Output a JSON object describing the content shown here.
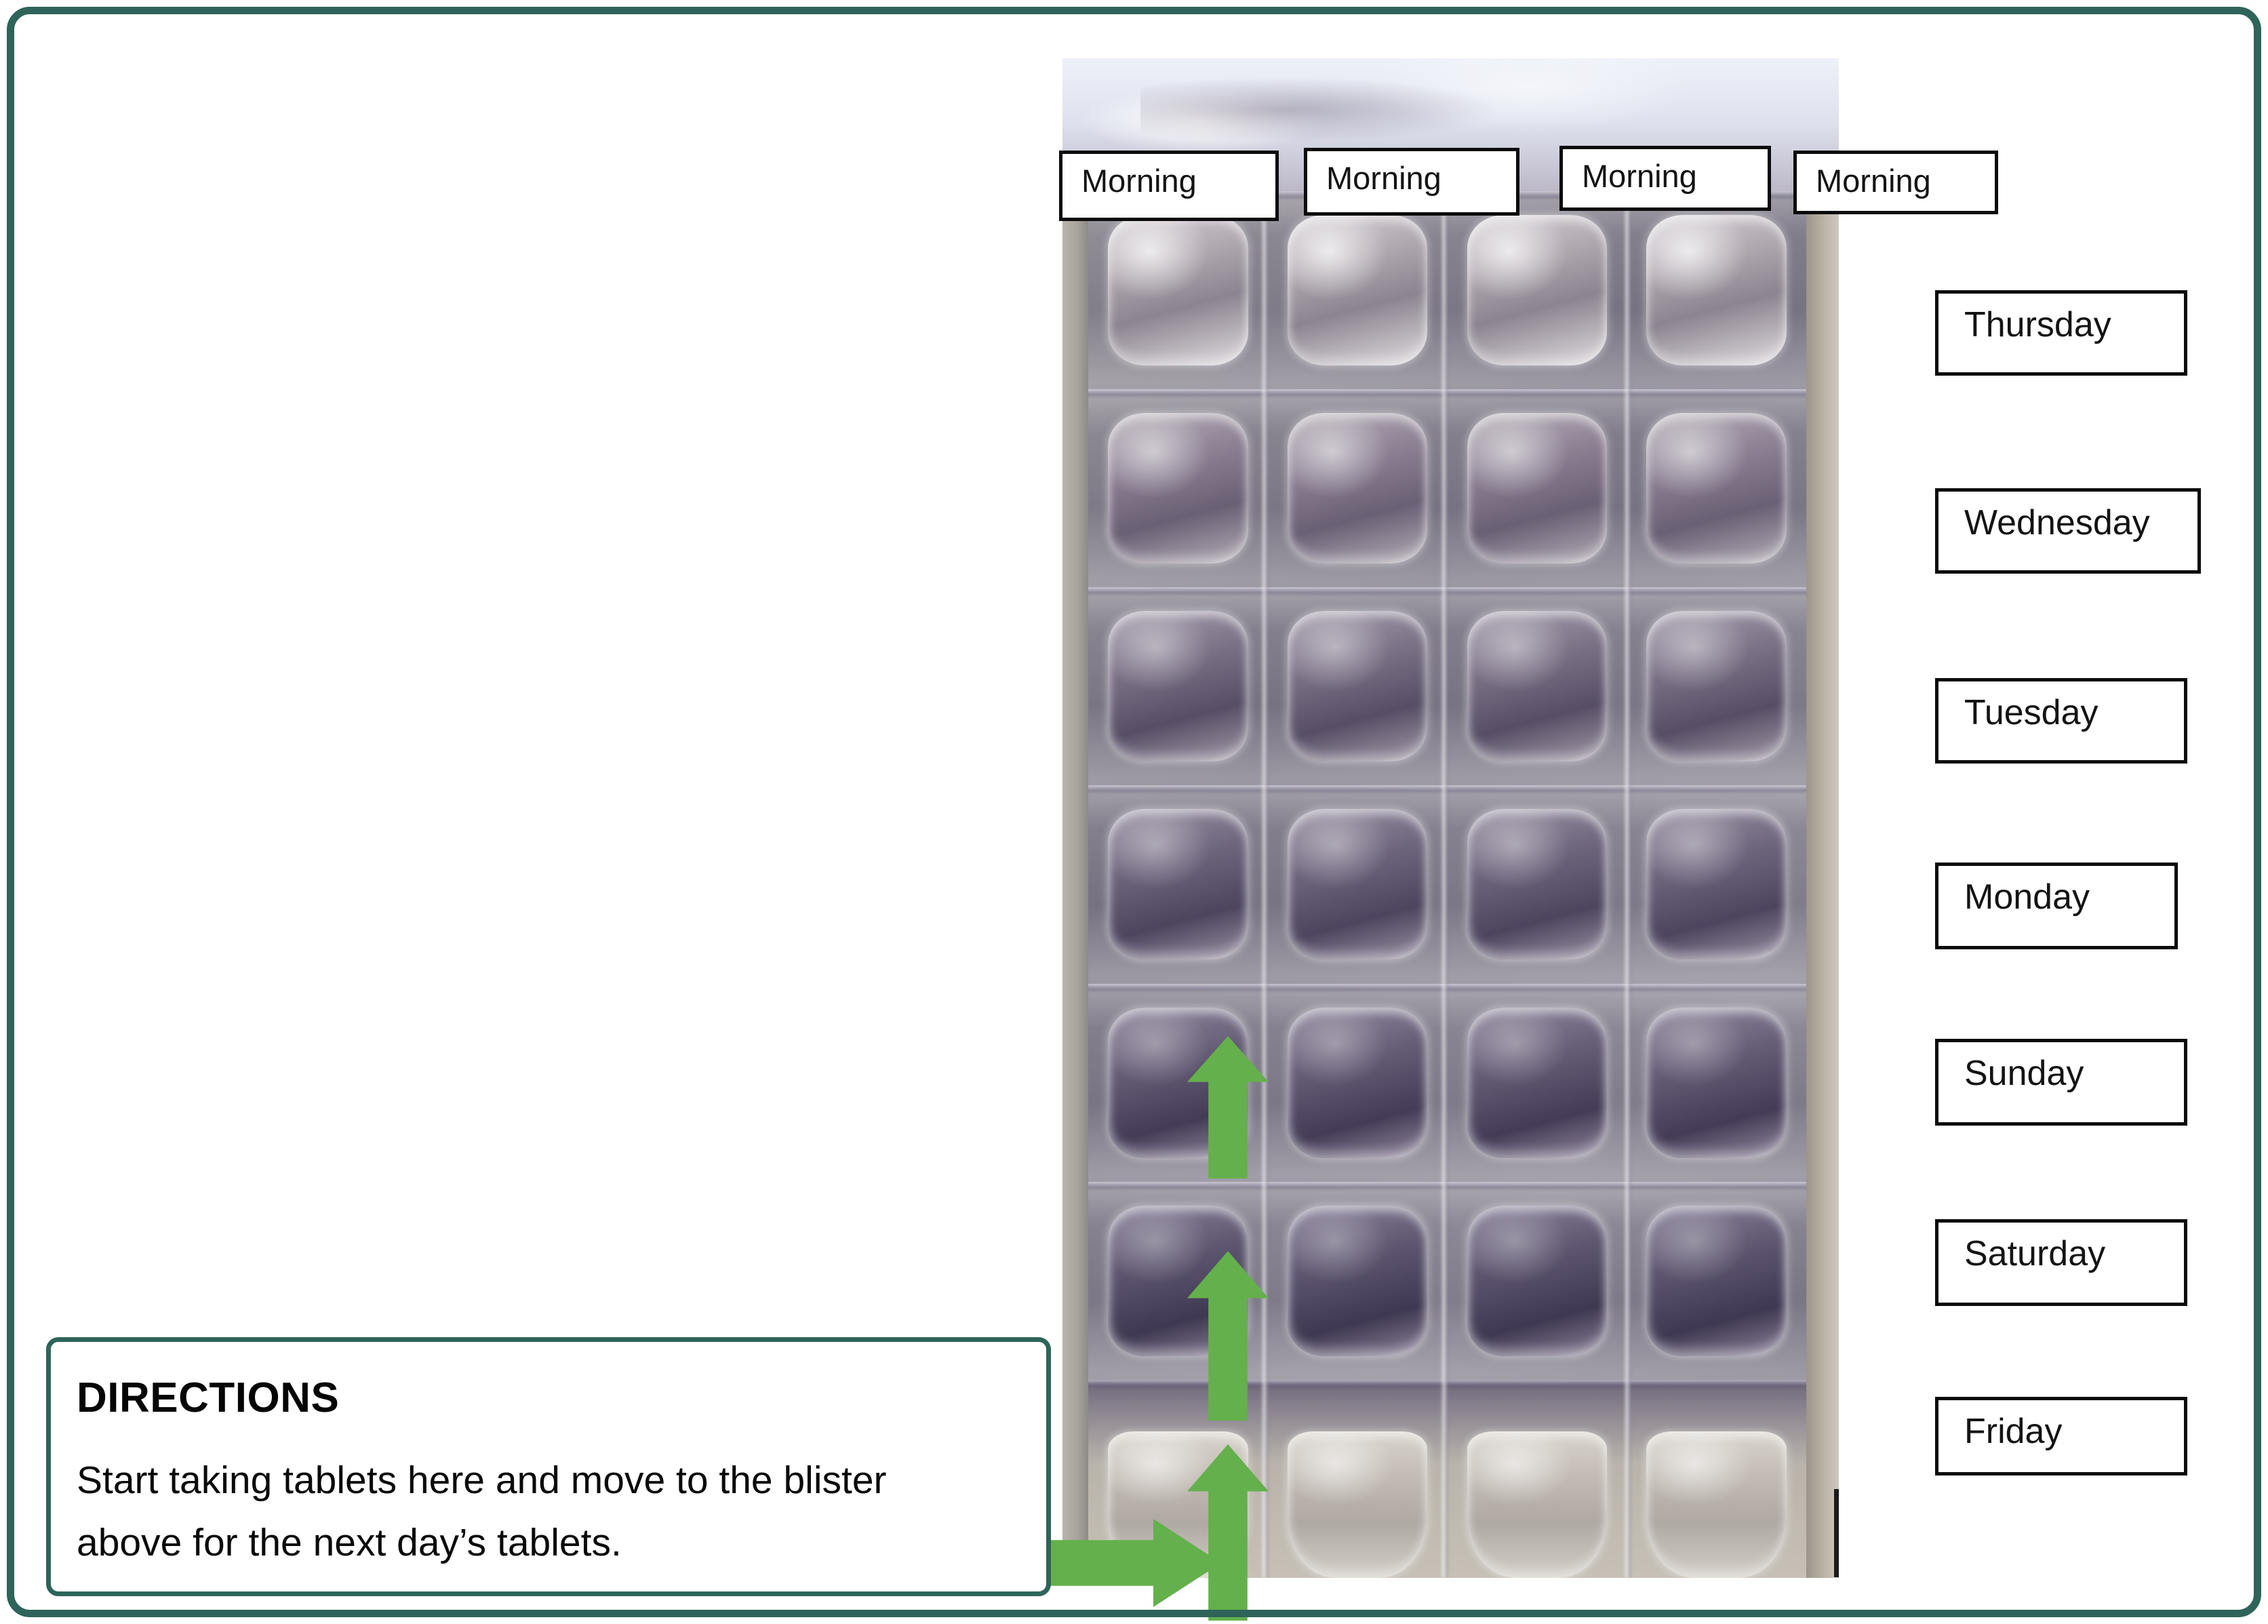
{
  "page": {
    "border_color": "#2e6459",
    "background": "#ffffff"
  },
  "photo": {
    "alt_name": "blister-pack-photo",
    "rows": 7,
    "columns": 4
  },
  "time_labels": [
    {
      "label": "Morning"
    },
    {
      "label": "Morning"
    },
    {
      "label": "Morning"
    },
    {
      "label": "Morning"
    }
  ],
  "weekday_labels": [
    {
      "label": "Thursday"
    },
    {
      "label": "Wednesday"
    },
    {
      "label": "Tuesday"
    },
    {
      "label": "Monday"
    },
    {
      "label": "Sunday"
    },
    {
      "label": "Saturday"
    },
    {
      "label": "Friday"
    }
  ],
  "arrows": {
    "color": "#64b04c",
    "up_count": 3,
    "right_count": 1,
    "icon_up": "arrow-up-icon",
    "icon_right": "arrow-right-icon"
  },
  "directions": {
    "title": "DIRECTIONS",
    "body": "Start taking tablets here and move to the blister above for the next day’s tablets.",
    "border_color": "#2e6459"
  }
}
